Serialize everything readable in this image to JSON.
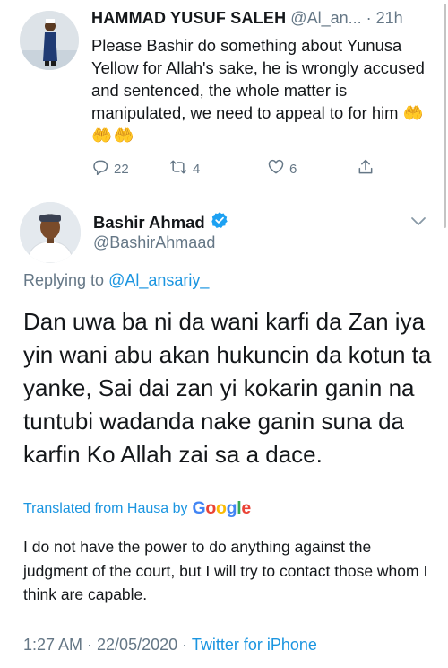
{
  "reply_tweet": {
    "display_name": "HAMMAD YUSUF SALEH",
    "handle": "@Al_an...",
    "separator": "·",
    "time": "21h",
    "text": "Please Bashir do something about Yunusa Yellow for Allah's sake, he is wrongly accused and sentenced, the whole matter is manipulated, we need to appeal to for him",
    "emoji": "🤲🤲🤲",
    "reply_count": "22",
    "retweet_count": "4",
    "like_count": "6"
  },
  "main_tweet": {
    "display_name": "Bashir Ahmad",
    "handle": "@BashirAhmaad",
    "replying_label": "Replying to",
    "replying_to": "@Al_ansariy_",
    "text": "Dan uwa ba ni da wani karfi da Zan iya yin wani abu akan hukuncin da kotun ta yanke, Sai dai zan yi kokarin ganin na tuntubi wadanda nake ganin suna da karfin Ko Allah zai sa a dace.",
    "translated_label": "Translated from Hausa by",
    "translation_provider": "Google",
    "translation": "I do not have the power to do anything against the judgment of the court, but I will try to contact those whom I think are capable.",
    "timestamp": "1:27 AM · 22/05/2020 ·",
    "source": "Twitter for iPhone"
  },
  "icons": [
    "reply-icon",
    "retweet-icon",
    "like-icon",
    "share-icon",
    "verified-badge-icon",
    "chevron-down-icon"
  ],
  "colors": {
    "link": "#1b95e0",
    "secondary": "#657786",
    "verified": "#1da1f2"
  }
}
